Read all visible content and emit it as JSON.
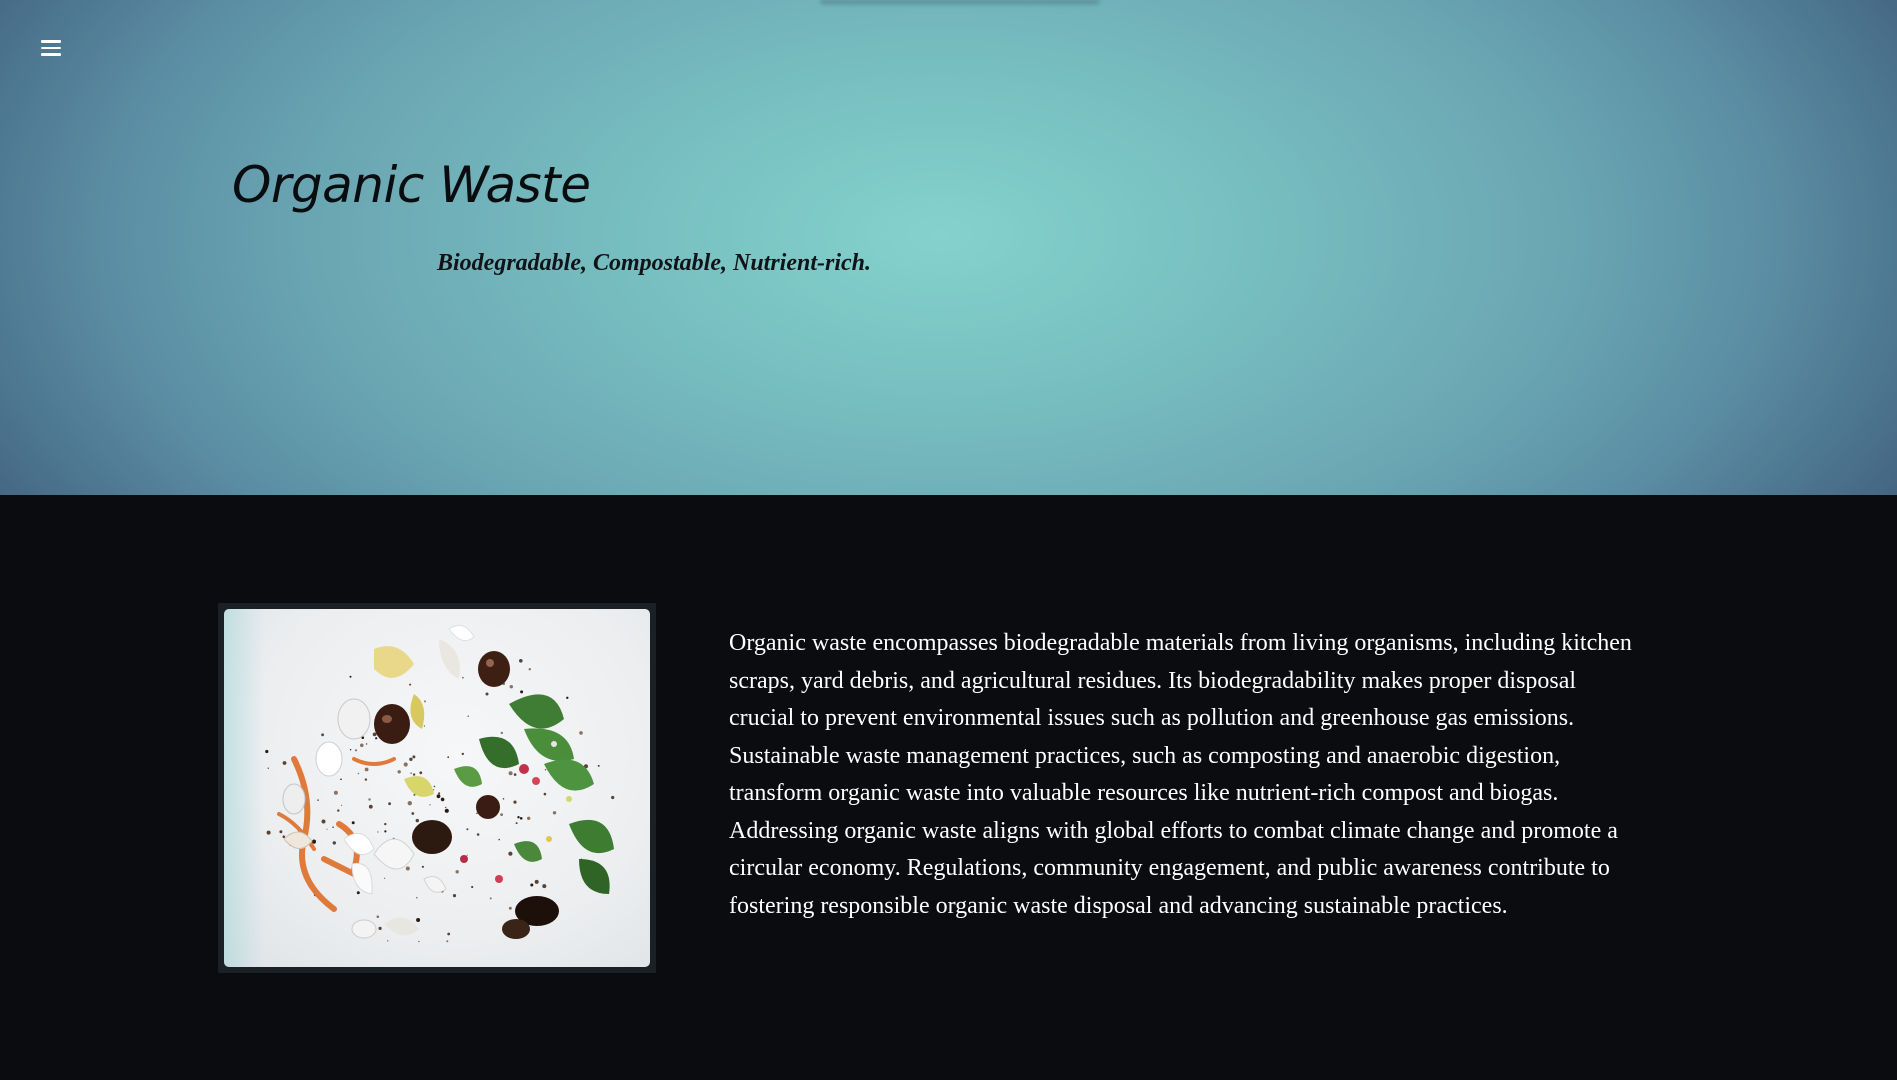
{
  "header": {
    "menu_icon": "hamburger-menu-icon",
    "title": "Organic Waste",
    "subtitle": "Biodegradable, Compostable, Nutrient-rich."
  },
  "main": {
    "image": {
      "subject": "Scattered organic food scraps: eggshells, vegetable peels, leafy greens, seeds and soil on a white background"
    },
    "description": "Organic waste encompasses biodegradable materials from living organisms, including kitchen scraps, yard debris, and agricultural residues. Its biodegradability makes proper disposal crucial to prevent environmental issues such as pollution and greenhouse gas emissions. Sustainable waste management practices, such as composting and anaerobic digestion, transform organic waste into valuable resources like nutrient-rich compost and biogas. Addressing organic waste aligns with global efforts to combat climate change and promote a circular economy. Regulations, community engagement, and public awareness contribute to fostering responsible organic waste disposal and advancing sustainable practices."
  },
  "colors": {
    "hero_center": "#84d2cd",
    "hero_edge": "#3c5877",
    "content_background": "#0b0c10",
    "title_text": "#0a0d10",
    "body_text": "#ffffff"
  }
}
